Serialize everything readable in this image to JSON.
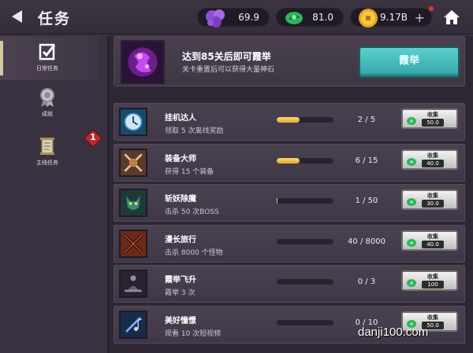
{
  "header": {
    "title": "任务",
    "currencies": [
      {
        "name": "gems",
        "value": "69.9"
      },
      {
        "name": "stone",
        "value": "81.0"
      },
      {
        "name": "gold",
        "value": "9.17B"
      }
    ]
  },
  "sidebar": {
    "items": [
      {
        "label": "日常任务"
      },
      {
        "label": "成就"
      },
      {
        "label": "主线任务"
      }
    ],
    "badge": "1"
  },
  "banner": {
    "title": "达到85关后即可霞举",
    "subtitle": "关卡重置后可以获得大量神石",
    "button": "霞举"
  },
  "tasks": [
    {
      "name": "挂机达人",
      "desc": "领取 5 次离线奖励",
      "progress": "2 / 5",
      "fill": 0.4,
      "collect": "收集",
      "reward": "50.0"
    },
    {
      "name": "装备大师",
      "desc": "获得 15 个装备",
      "progress": "6 / 15",
      "fill": 0.4,
      "collect": "收集",
      "reward": "40.0"
    },
    {
      "name": "斩妖除魔",
      "desc": "击杀 50 次BOSS",
      "progress": "1 / 50",
      "fill": 0.02,
      "collect": "收集",
      "reward": "30.0"
    },
    {
      "name": "漫长旅行",
      "desc": "击杀 8000 个怪物",
      "progress": "40 / 8000",
      "fill": 0.005,
      "collect": "收集",
      "reward": "40.0"
    },
    {
      "name": "霞举飞升",
      "desc": "霞举 3 次",
      "progress": "0 / 3",
      "fill": 0,
      "collect": "收集",
      "reward": "100"
    },
    {
      "name": "美好憧憬",
      "desc": "观看 10 次短视频",
      "progress": "0 / 10",
      "fill": 0,
      "collect": "收集",
      "reward": "50.0"
    }
  ],
  "colors": {
    "accent_teal": "#45bcbc",
    "progress_gold": "#e2a82b",
    "badge_red": "#c0303a"
  },
  "watermark": "danji100.com"
}
